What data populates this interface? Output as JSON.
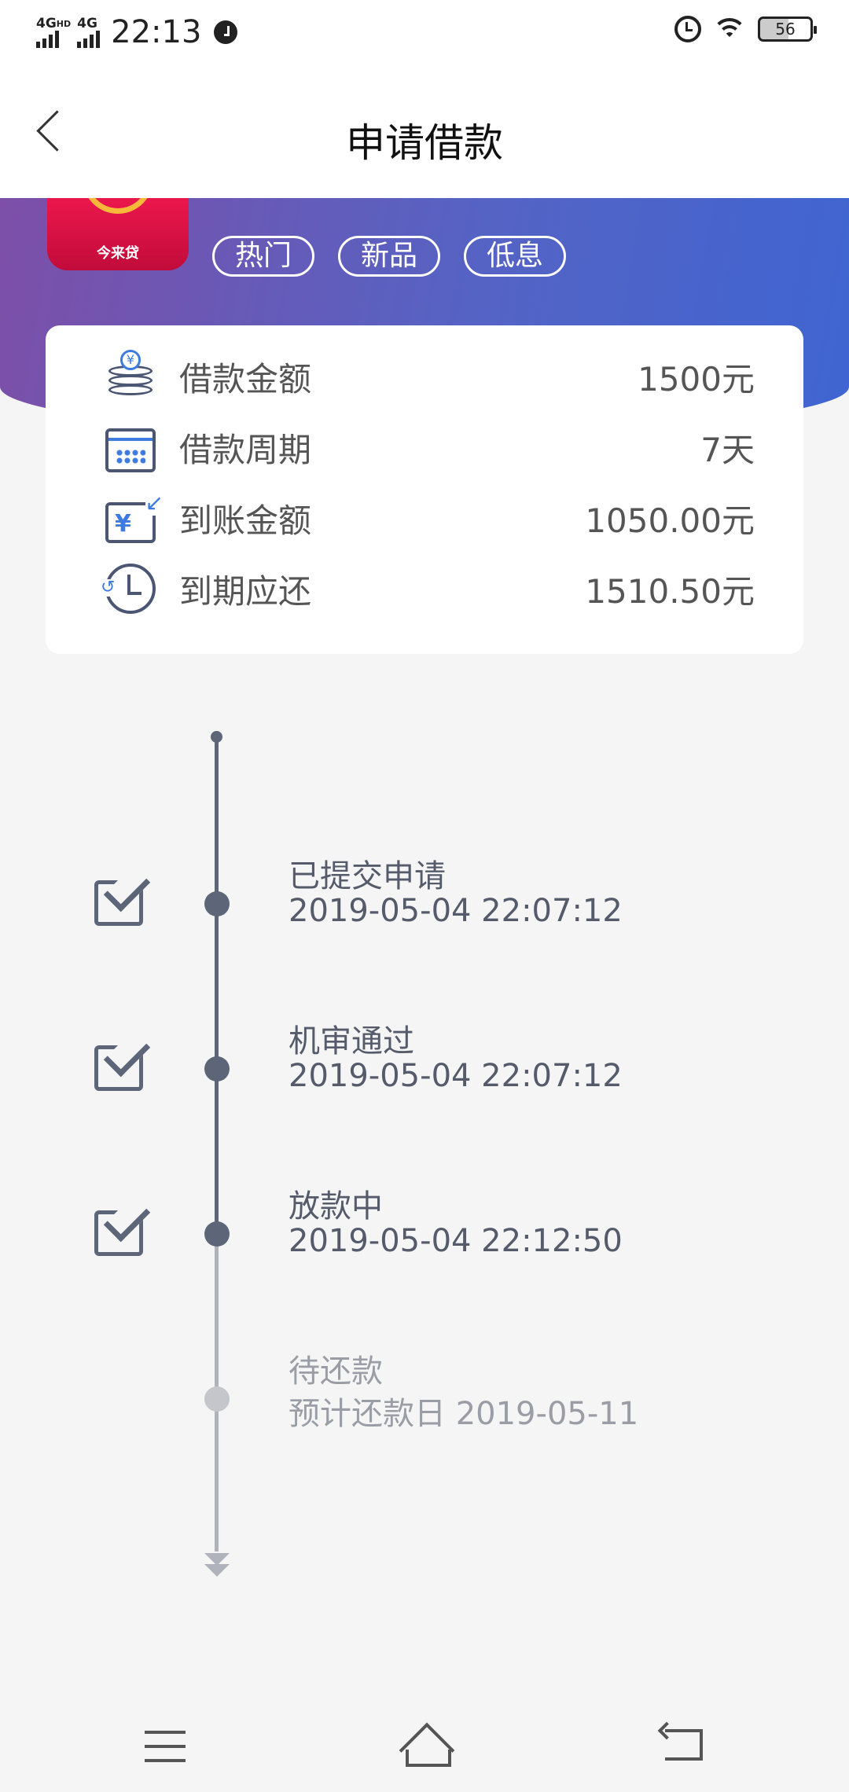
{
  "status_bar": {
    "network1": "4G",
    "network1_sup": "HD",
    "network2": "4G",
    "time": "22:13",
    "battery": "56",
    "icons": [
      "signal-icon",
      "clock-icon",
      "alarm-icon",
      "wifi-icon",
      "battery-icon"
    ]
  },
  "nav": {
    "title": "申请借款",
    "back_icon": "chevron-left-icon"
  },
  "banner": {
    "app_name": "今来贷",
    "tags": [
      "热门",
      "新品",
      "低息"
    ],
    "accent_colors": [
      "#7d4fa8",
      "#3f65d2"
    ]
  },
  "info": {
    "rows": [
      {
        "icon": "coins-icon",
        "label": "借款金额",
        "value": "1500元"
      },
      {
        "icon": "calendar-icon",
        "label": "借款周期",
        "value": "7天"
      },
      {
        "icon": "receive-money-icon",
        "label": "到账金额",
        "value": "1050.00元"
      },
      {
        "icon": "due-clock-icon",
        "label": "到期应还",
        "value": "1510.50元"
      }
    ]
  },
  "timeline": {
    "steps": [
      {
        "title": "已提交申请",
        "date": "2019-05-04 22:07:12",
        "done": true
      },
      {
        "title": "机审通过",
        "date": "2019-05-04 22:07:12",
        "done": true
      },
      {
        "title": "放款中",
        "date": "2019-05-04 22:12:50",
        "done": true
      },
      {
        "title": "待还款",
        "date": "预计还款日 2019-05-11",
        "done": false
      }
    ]
  },
  "bottom_nav": {
    "icons": [
      "menu-icon",
      "home-icon",
      "back-icon"
    ]
  }
}
